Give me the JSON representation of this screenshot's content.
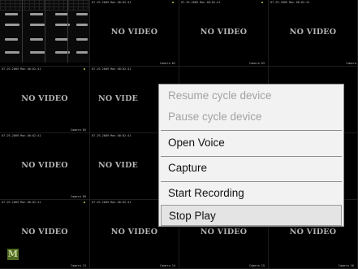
{
  "tiles": [
    {
      "ts": "",
      "cam": "",
      "no_video": "",
      "preview": true
    },
    {
      "ts": "07-29-2009 Mon 00:02:41",
      "cam": "Camera 02",
      "no_video": "NO VIDEO"
    },
    {
      "ts": "07-29-2009 Mon 00:02:41",
      "cam": "Camera 03",
      "no_video": "NO VIDEO"
    },
    {
      "ts": "07-29-2009 Mon 00:02:41",
      "cam": "Camera",
      "no_video": "NO VIDEO"
    },
    {
      "ts": "07-29-2009 Mon 00:02:41",
      "cam": "Camera 05",
      "no_video": "NO VIDEO"
    },
    {
      "ts": "07-29-2009 Mon 00:02:41",
      "cam": "",
      "no_video": "NO VIDE"
    },
    {
      "ts": "",
      "cam": "",
      "no_video": ""
    },
    {
      "ts": "",
      "cam": "",
      "no_video": ""
    },
    {
      "ts": "07-29-2009 Mon 00:02:41",
      "cam": "Camera 09",
      "no_video": "NO VIDEO"
    },
    {
      "ts": "07-29-2009 Mon 00:02:41",
      "cam": "",
      "no_video": "NO VIDE"
    },
    {
      "ts": "",
      "cam": "",
      "no_video": ""
    },
    {
      "ts": "",
      "cam": "",
      "no_video": ""
    },
    {
      "ts": "07-29-2009 Mon 00:02:41",
      "cam": "Camera 13",
      "no_video": "NO VIDEO"
    },
    {
      "ts": "07-29-2009 Mon 00:02:41",
      "cam": "Camera 14",
      "no_video": "NO VIDEO"
    },
    {
      "ts": "07-29-2009 Mon 00:02:41",
      "cam": "Camera 15",
      "no_video": "NO VIDEO"
    },
    {
      "ts": "07-29-2009 Mon 00:02:41",
      "cam": "Camera 16",
      "no_video": "NO VIDEO"
    }
  ],
  "logo_letter": "M",
  "context_menu": {
    "items": [
      {
        "label": "Resume cycle device",
        "enabled": false
      },
      {
        "label": "Pause cycle device",
        "enabled": false
      },
      {
        "label": "Open Voice",
        "enabled": true
      },
      {
        "label": "Capture",
        "enabled": true
      },
      {
        "label": "Start Recording",
        "enabled": true
      },
      {
        "label": "Stop Play",
        "enabled": true,
        "highlighted": true
      }
    ]
  },
  "colors": {
    "background": "#000000",
    "no_video_text": "#b6b6b6",
    "menu_bg": "#f2f2f2",
    "menu_disabled_text": "#a3a3a3",
    "rec_indicator": "#8a9a3a"
  }
}
